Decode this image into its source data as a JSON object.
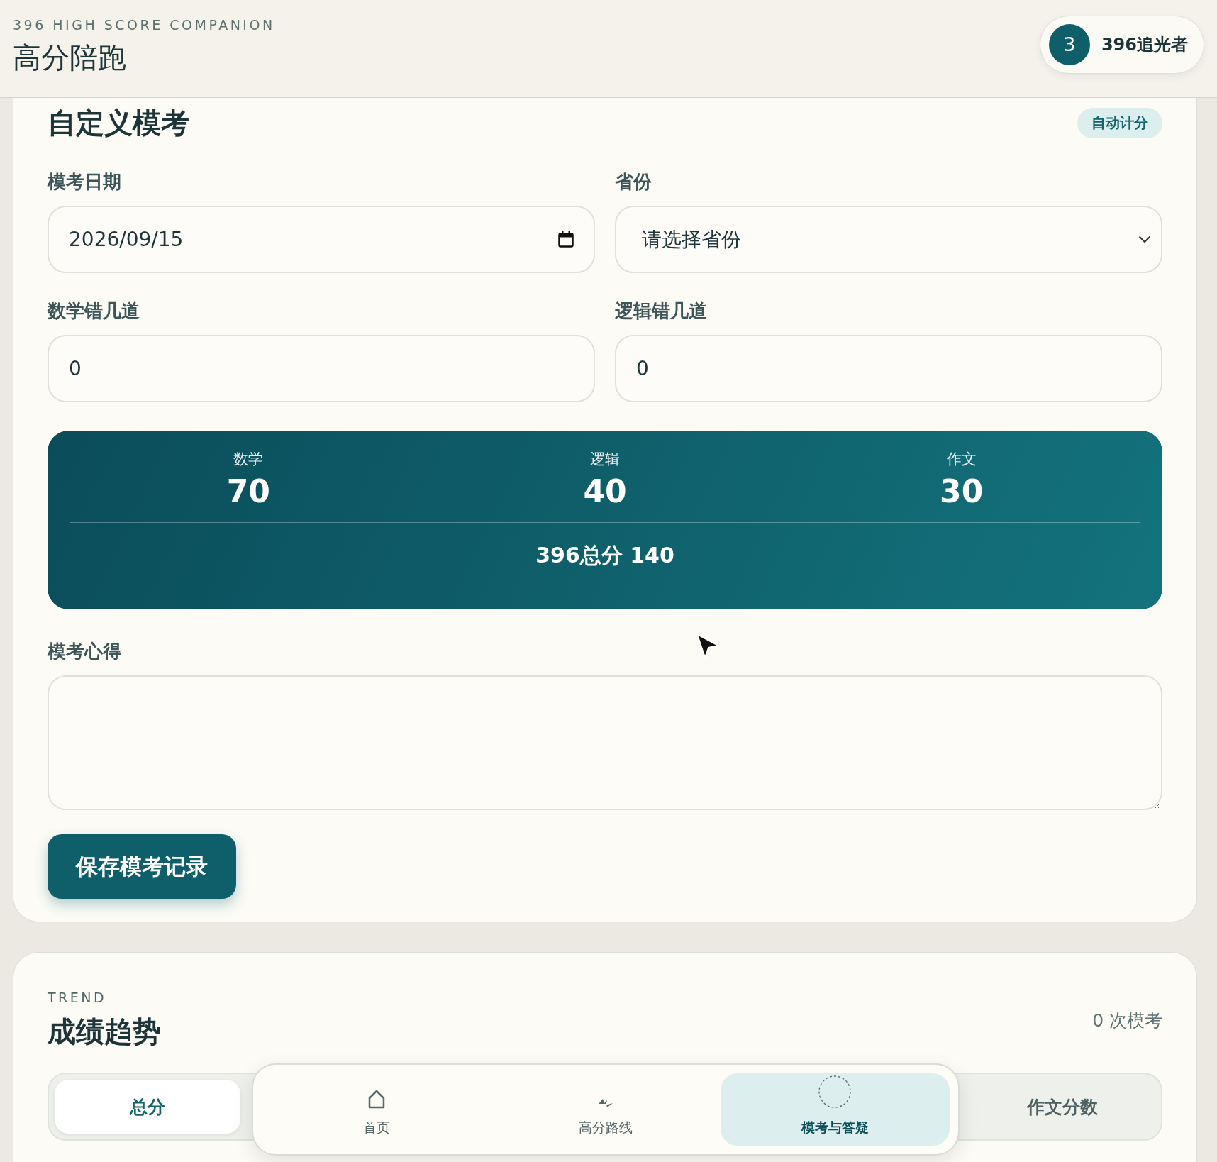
{
  "header": {
    "eyebrow": "396 HIGH SCORE COMPANION",
    "title": "高分陪跑",
    "user": {
      "avatar": "3",
      "name": "396追光者"
    }
  },
  "exam_form": {
    "title": "自定义模考",
    "badge": "自动计分",
    "date": {
      "label": "模考日期",
      "value": "2026/09/15"
    },
    "province": {
      "label": "省份",
      "placeholder": "请选择省份"
    },
    "math_wrong": {
      "label": "数学错几道",
      "value": "0"
    },
    "logic_wrong": {
      "label": "逻辑错几道",
      "value": "0"
    },
    "scores": [
      {
        "label": "数学",
        "value": "70"
      },
      {
        "label": "逻辑",
        "value": "40"
      },
      {
        "label": "作文",
        "value": "30"
      }
    ],
    "total": "396总分 140",
    "notes": {
      "label": "模考心得"
    },
    "save_button": "保存模考记录"
  },
  "trend": {
    "eyebrow": "TREND",
    "title": "成绩趋势",
    "count": "0 次模考",
    "tabs": [
      {
        "label": "总分",
        "selected": true
      },
      {
        "label": "作文分数",
        "selected": false
      }
    ]
  },
  "nav": [
    {
      "label": "首页",
      "selected": false
    },
    {
      "label": "高分路线",
      "selected": false
    },
    {
      "label": "模考与答疑",
      "selected": true
    }
  ]
}
